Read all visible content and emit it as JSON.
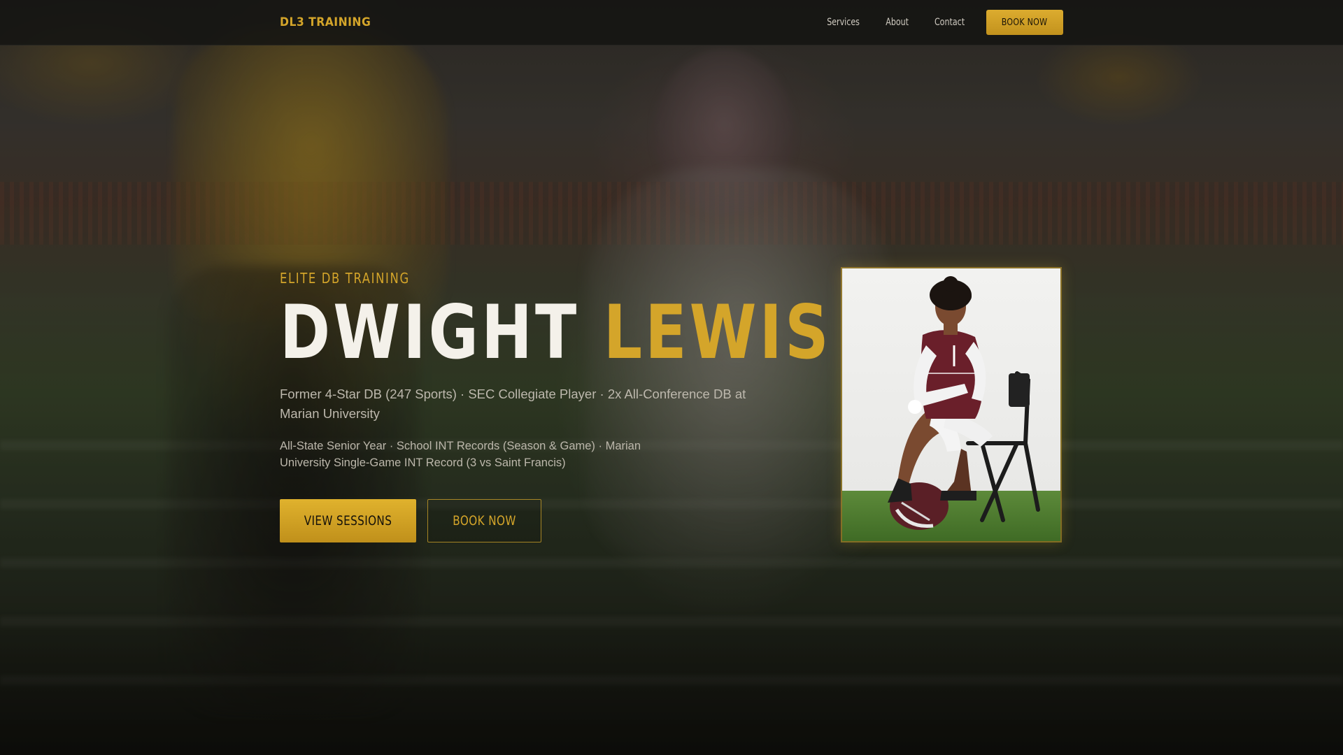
{
  "nav": {
    "brand": "DL3 TRAINING",
    "links": [
      "Services",
      "About",
      "Contact"
    ],
    "cta": "BOOK NOW"
  },
  "hero": {
    "eyebrow": "ELITE DB TRAINING",
    "title_first": "DWIGHT",
    "title_last": "LEWIS III",
    "subline": "Former 4-Star DB (247 Sports) · SEC Collegiate Player · 2x All-Conference DB at Marian University",
    "achievements": "All-State Senior Year · School INT Records (Season & Game) · Marian University Single-Game INT Record (3 vs Saint Francis)",
    "primary_cta": "VIEW SESSIONS",
    "secondary_cta": "BOOK NOW"
  },
  "colors": {
    "accent": "#d4a52a",
    "background": "#15130f",
    "heading": "#f4f1ea"
  }
}
